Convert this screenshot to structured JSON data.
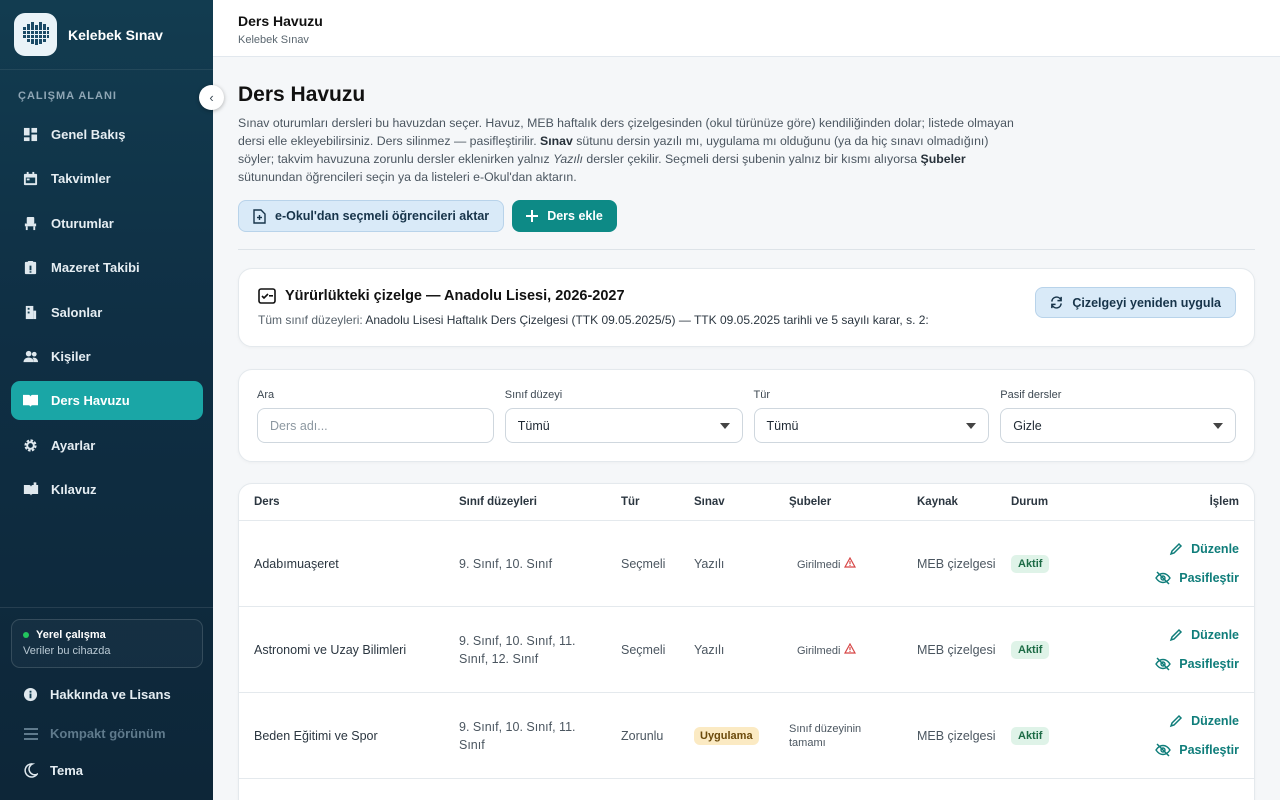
{
  "sidebar": {
    "brand": "Kelebek Sınav",
    "section": "ÇALIŞMA ALANI",
    "items": [
      {
        "label": "Genel Bakış",
        "icon": "dashboard-icon"
      },
      {
        "label": "Takvimler",
        "icon": "calendar-icon"
      },
      {
        "label": "Oturumlar",
        "icon": "chair-icon"
      },
      {
        "label": "Mazeret Takibi",
        "icon": "report-icon"
      },
      {
        "label": "Salonlar",
        "icon": "building-icon"
      },
      {
        "label": "Kişiler",
        "icon": "people-icon"
      },
      {
        "label": "Ders Havuzu",
        "icon": "book-icon",
        "active": true
      },
      {
        "label": "Ayarlar",
        "icon": "gear-icon"
      },
      {
        "label": "Kılavuz",
        "icon": "guide-icon"
      }
    ],
    "local": {
      "title": "Yerel çalışma",
      "subtitle": "Veriler bu cihazda"
    },
    "about": "Hakkında ve Lisans",
    "compact": "Kompakt görünüm",
    "theme": "Tema"
  },
  "topbar": {
    "title": "Ders Havuzu",
    "subtitle": "Kelebek Sınav"
  },
  "page": {
    "title": "Ders Havuzu",
    "desc": {
      "p1": "Sınav oturumları dersleri bu havuzdan seçer. Havuz, MEB haftalık ders çizelgesinden (okul türünüze göre) kendiliğinden dolar; listede olmayan dersi elle ekleyebilirsiniz. Ders silinmez — pasifleştirilir. ",
      "b1": "Sınav",
      "p2": " sütunu dersin yazılı mı, uygulama mı olduğunu (ya da hiç sınavı olmadığını) söyler; takvim havuzuna zorunlu dersler eklenirken yalnız ",
      "i1": "Yazılı",
      "p3": " dersler çekilir. Seçmeli dersi şubenin yalnız bir kısmı alıyorsa ",
      "b2": "Şubeler",
      "p4": " sütunundan öğrencileri seçin ya da listeleri e-Okul'dan aktarın."
    },
    "import_button": "e-Okul'dan seçmeli öğrencileri aktar",
    "add_button": "Ders ekle"
  },
  "schedule": {
    "title": "Yürürlükteki çizelge — Anadolu Lisesi, 2026-2027",
    "label": "Tüm sınıf düzeyleri:",
    "value": "Anadolu Lisesi Haftalık Ders Çizelgesi (TTK 09.05.2025/5) — TTK 09.05.2025 tarihli ve 5 sayılı karar, s. 2:",
    "reapply": "Çizelgeyi yeniden uygula"
  },
  "filters": {
    "search_label": "Ara",
    "search_placeholder": "Ders adı...",
    "grade_label": "Sınıf düzeyi",
    "grade_value": "Tümü",
    "type_label": "Tür",
    "type_value": "Tümü",
    "passive_label": "Pasif dersler",
    "passive_value": "Gizle"
  },
  "table": {
    "headers": [
      "Ders",
      "Sınıf düzeyleri",
      "Tür",
      "Sınav",
      "Şubeler",
      "Kaynak",
      "Durum",
      "İşlem"
    ],
    "edit": "Düzenle",
    "deactivate": "Pasifleştir",
    "rows": [
      {
        "name": "Adabımuaşeret",
        "grades": "9. Sınıf, 10. Sınıf",
        "type": "Seçmeli",
        "exam": "Yazılı",
        "branches": "Girilmedi",
        "source": "MEB çizelgesi",
        "status": "Aktif"
      },
      {
        "name": "Astronomi ve Uzay Bilimleri",
        "grades": "9. Sınıf, 10. Sınıf, 11. Sınıf, 12. Sınıf",
        "type": "Seçmeli",
        "exam": "Yazılı",
        "branches": "Girilmedi",
        "source": "MEB çizelgesi",
        "status": "Aktif"
      },
      {
        "name": "Beden Eğitimi ve Spor",
        "grades": "9. Sınıf, 10. Sınıf, 11. Sınıf",
        "type": "Zorunlu",
        "exam": "Uygulama",
        "branches": "Sınıf düzeyinin tamamı",
        "source": "MEB çizelgesi",
        "status": "Aktif"
      }
    ]
  }
}
